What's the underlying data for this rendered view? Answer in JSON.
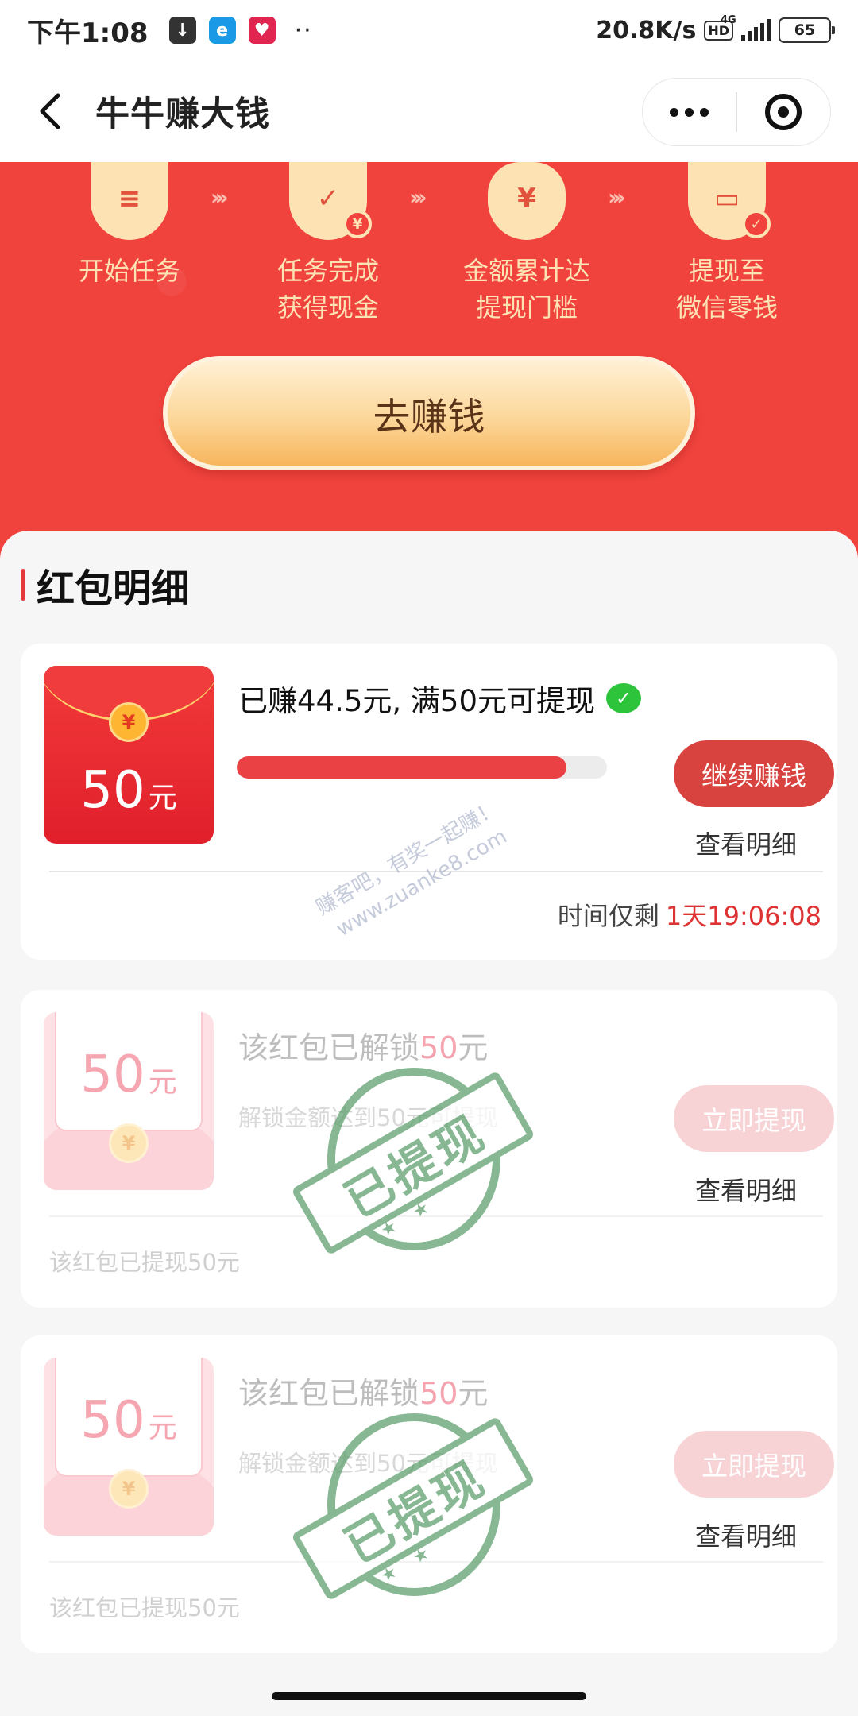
{
  "status_bar": {
    "time": "下午1:08",
    "more": "··",
    "net_speed": "20.8K/s",
    "hd": "HD",
    "network": "4G",
    "battery": "65"
  },
  "nav": {
    "title": "牛牛赚大钱"
  },
  "hero": {
    "steps": [
      {
        "label": "开始任务"
      },
      {
        "label": "任务完成\n获得现金"
      },
      {
        "label": "金额累计达\n提现门槛"
      },
      {
        "label": "提现至\n微信零钱"
      }
    ],
    "arrow": "›››",
    "cta_label": "去赚钱"
  },
  "section": {
    "title": "红包明细"
  },
  "cards": [
    {
      "envelope_amount": "50",
      "envelope_unit": "元",
      "seal": "¥",
      "earned_text": "已赚44.5元, 满50元可提现",
      "progress": 0.89,
      "button_label": "继续赚钱",
      "detail_link": "查看明细",
      "countdown_label": "时间仅剩",
      "countdown_time": "1天19:06:08"
    },
    {
      "envelope_amount": "50",
      "envelope_unit": "元",
      "seal": "¥",
      "unlock_prefix": "该红包已解锁",
      "unlock_amount": "50",
      "unlock_unit": "元",
      "sub_text": "解锁金额达到50元可提现",
      "button_label": "立即提现",
      "detail_link": "查看明细",
      "stamp_text": "已提现",
      "note": "该红包已提现50元"
    },
    {
      "envelope_amount": "50",
      "envelope_unit": "元",
      "seal": "¥",
      "unlock_prefix": "该红包已解锁",
      "unlock_amount": "50",
      "unlock_unit": "元",
      "sub_text": "解锁金额达到50元可提现",
      "button_label": "立即提现",
      "detail_link": "查看明细",
      "stamp_text": "已提现",
      "note": "该红包已提现50元"
    }
  ],
  "watermark": {
    "line1": "赚客吧，有奖一起赚！",
    "line2": "www.zuanke8.com"
  },
  "colors": {
    "hero_red": "#f0433e",
    "accent_red": "#e4393c",
    "button_red": "#d9433f",
    "stamp_green": "#5a9e6a",
    "cta_gold": "#fcd79a"
  }
}
